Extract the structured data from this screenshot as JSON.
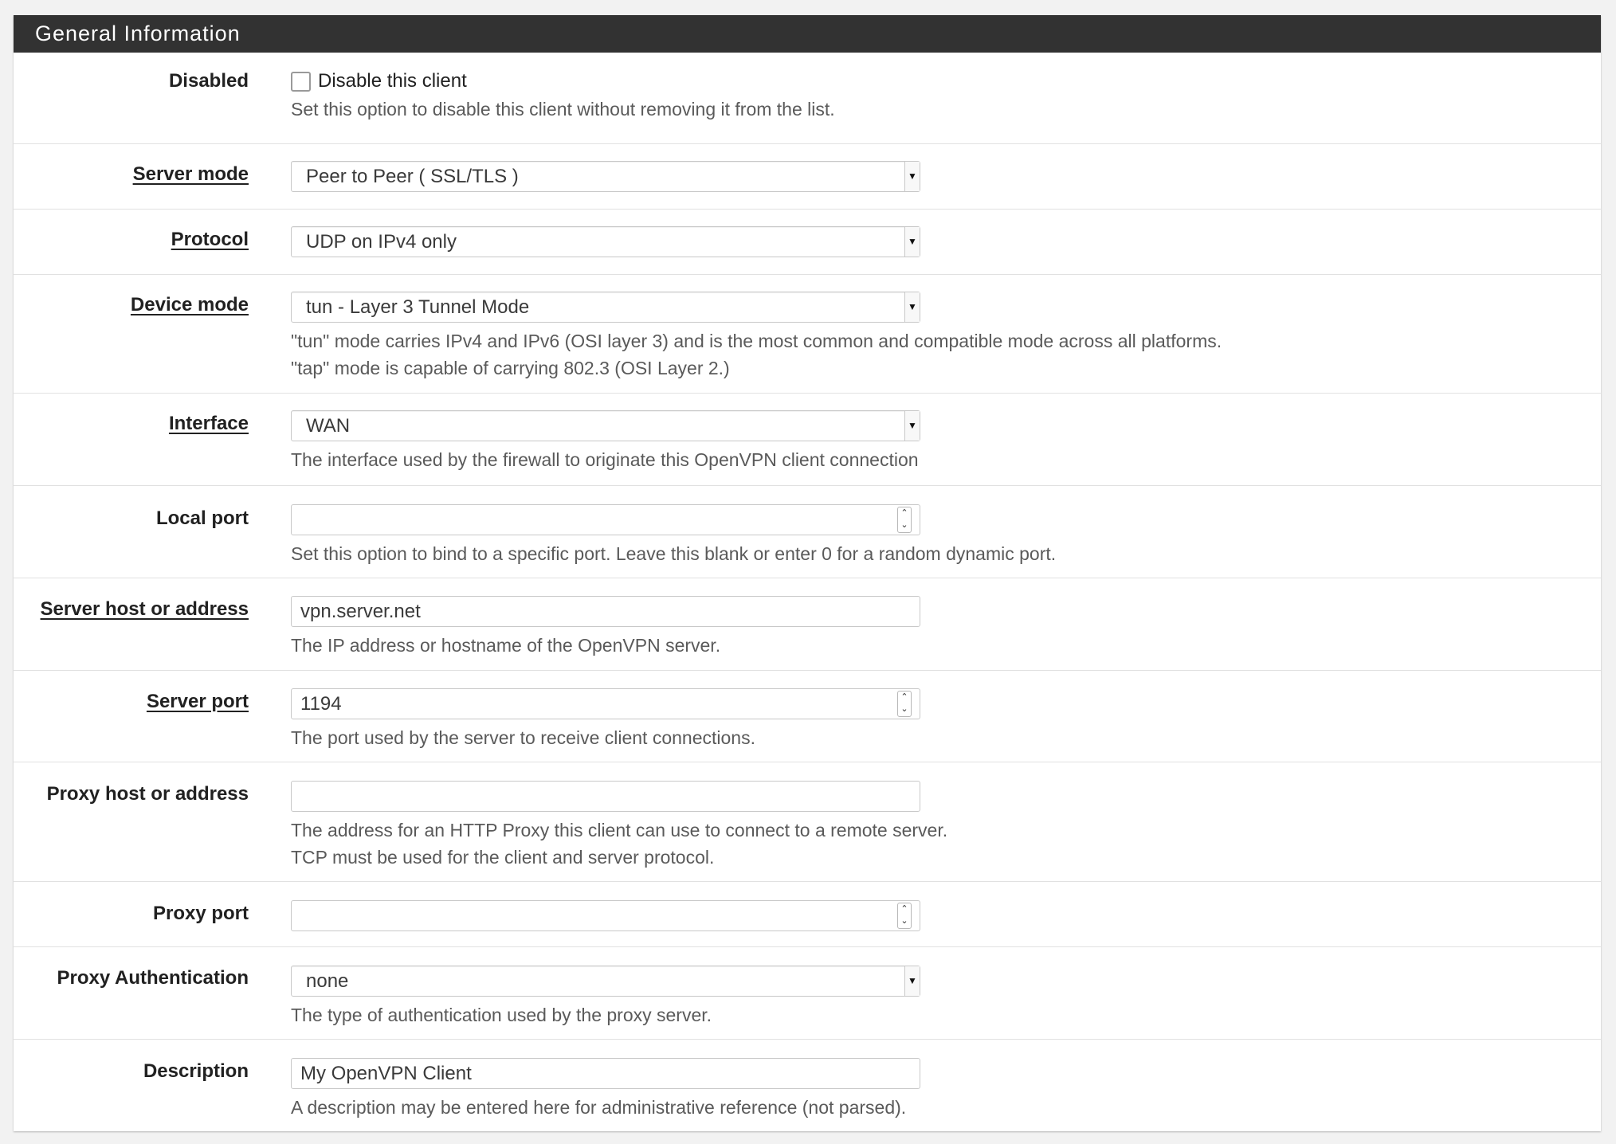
{
  "panel": {
    "title": "General Information"
  },
  "fields": {
    "disabled": {
      "label": "Disabled",
      "checkbox_label": "Disable this client",
      "checked": false,
      "help": "Set this option to disable this client without removing it from the list."
    },
    "server_mode": {
      "label": "Server mode",
      "value": "Peer to Peer ( SSL/TLS )"
    },
    "protocol": {
      "label": "Protocol",
      "value": "UDP on IPv4 only"
    },
    "device_mode": {
      "label": "Device mode",
      "value": "tun - Layer 3 Tunnel Mode",
      "help1": "\"tun\" mode carries IPv4 and IPv6 (OSI layer 3) and is the most common and compatible mode across all platforms.",
      "help2": "\"tap\" mode is capable of carrying 802.3 (OSI Layer 2.)"
    },
    "interface": {
      "label": "Interface",
      "value": "WAN",
      "help": "The interface used by the firewall to originate this OpenVPN client connection"
    },
    "local_port": {
      "label": "Local port",
      "value": "",
      "help": "Set this option to bind to a specific port. Leave this blank or enter 0 for a random dynamic port."
    },
    "server_host": {
      "label": "Server host or address",
      "value": "vpn.server.net",
      "help": "The IP address or hostname of the OpenVPN server."
    },
    "server_port": {
      "label": "Server port",
      "value": "1194",
      "help": "The port used by the server to receive client connections."
    },
    "proxy_host": {
      "label": "Proxy host or address",
      "value": "",
      "help1": "The address for an HTTP Proxy this client can use to connect to a remote server.",
      "help2": "TCP must be used for the client and server protocol."
    },
    "proxy_port": {
      "label": "Proxy port",
      "value": ""
    },
    "proxy_auth": {
      "label": "Proxy Authentication",
      "value": "none",
      "help": "The type of authentication used by the proxy server."
    },
    "description": {
      "label": "Description",
      "value": "My OpenVPN Client",
      "help": "A description may be entered here for administrative reference (not parsed)."
    }
  },
  "colors": {
    "header_bg": "#323232",
    "header_text": "#ffffff",
    "page_bg": "#f2f2f2",
    "help_text": "#5a5a5a"
  }
}
